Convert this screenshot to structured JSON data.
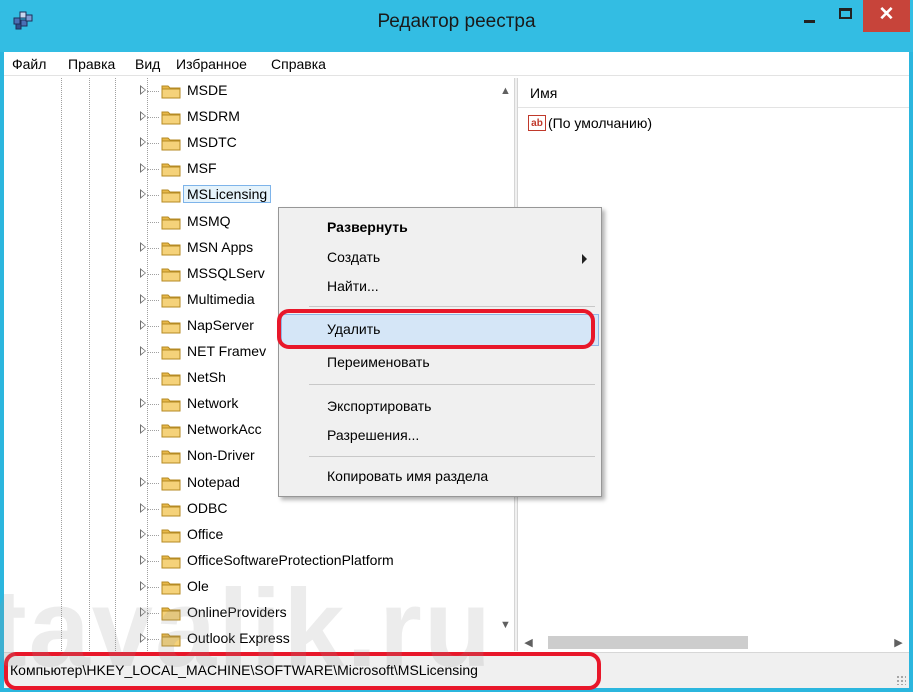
{
  "window": {
    "title": "Редактор реестра"
  },
  "menubar": {
    "items": [
      "Файл",
      "Правка",
      "Вид",
      "Избранное",
      "Справка"
    ]
  },
  "tree": {
    "nodes": [
      {
        "label": "MSDE",
        "expandable": true
      },
      {
        "label": "MSDRM",
        "expandable": true
      },
      {
        "label": "MSDTC",
        "expandable": true
      },
      {
        "label": "MSF",
        "expandable": true
      },
      {
        "label": "MSLicensing",
        "expandable": true,
        "selected": true
      },
      {
        "label": "MSMQ",
        "expandable": false
      },
      {
        "label": "MSN Apps",
        "expandable": true
      },
      {
        "label": "MSSQLServ",
        "expandable": true
      },
      {
        "label": "Multimedia",
        "expandable": true
      },
      {
        "label": "NapServer",
        "expandable": true
      },
      {
        "label": "NET Framev",
        "expandable": true
      },
      {
        "label": "NetSh",
        "expandable": false
      },
      {
        "label": "Network",
        "expandable": true
      },
      {
        "label": "NetworkAcc",
        "expandable": true
      },
      {
        "label": "Non-Driver",
        "expandable": false
      },
      {
        "label": "Notepad",
        "expandable": true
      },
      {
        "label": "ODBC",
        "expandable": true
      },
      {
        "label": "Office",
        "expandable": true
      },
      {
        "label": "OfficeSoftwareProtectionPlatform",
        "expandable": true
      },
      {
        "label": "Ole",
        "expandable": true
      },
      {
        "label": "OnlineProviders",
        "expandable": true
      },
      {
        "label": "Outlook Express",
        "expandable": true
      }
    ]
  },
  "values_pane": {
    "column_name": "Имя",
    "rows": [
      {
        "name": "(По умолчанию)",
        "icon": "string-value-icon"
      }
    ]
  },
  "context_menu": {
    "expand": "Развернуть",
    "create": "Создать",
    "find": "Найти...",
    "delete": "Удалить",
    "rename": "Переименовать",
    "export": "Экспортировать",
    "permissions": "Разрешения...",
    "copy_key_name": "Копировать имя раздела"
  },
  "statusbar": {
    "path": "Компьютер\\HKEY_LOCAL_MACHINE\\SOFTWARE\\Microsoft\\MSLicensing"
  },
  "watermark": "tavalik.ru",
  "colors": {
    "titlebar": "#33bde3",
    "close_button": "#c7443a",
    "highlight": "#e8172a",
    "menu_hover": "#d5e6f7"
  }
}
